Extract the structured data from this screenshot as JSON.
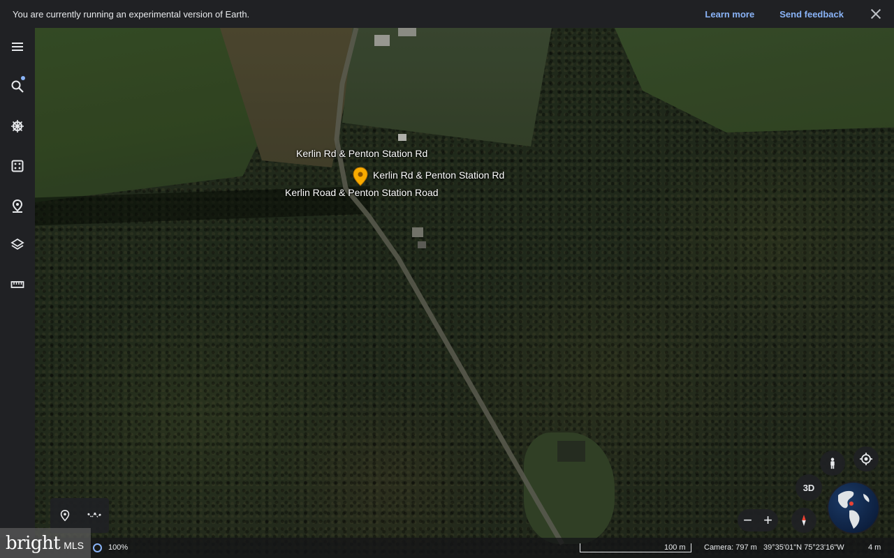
{
  "banner": {
    "message": "You are currently running an experimental version of Earth.",
    "learn_more": "Learn more",
    "send_feedback": "Send feedback",
    "close_icon": "close-icon"
  },
  "rail": {
    "items": [
      {
        "icon": "menu-icon"
      },
      {
        "icon": "search-icon",
        "notification": true
      },
      {
        "icon": "voyager-icon"
      },
      {
        "icon": "feeling-lucky-icon"
      },
      {
        "icon": "projects-icon"
      },
      {
        "icon": "map-style-icon"
      },
      {
        "icon": "measure-icon"
      }
    ]
  },
  "map": {
    "labels": {
      "label_1": "Kerlin Rd & Penton Station Rd",
      "label_2": "Kerlin Rd & Penton Station Rd",
      "label_3": "Kerlin Road & Penton Station Road"
    },
    "pin_color": "#f9ab00"
  },
  "toolbox": {
    "add_placemark_icon": "placemark-icon",
    "draw_path_icon": "path-icon"
  },
  "status": {
    "load_percent": "100%",
    "scale": "100 m",
    "camera": "Camera: 797 m",
    "coordinates": "39°35'01\"N 75°23'16\"W",
    "altitude": "4 m"
  },
  "watermark": {
    "brand": "bright",
    "suffix": "MLS"
  },
  "controls": {
    "three_d": "3D",
    "zoom_out": "−",
    "zoom_in": "+"
  },
  "colors": {
    "accent": "#8ab4f8",
    "panel": "#202124"
  }
}
